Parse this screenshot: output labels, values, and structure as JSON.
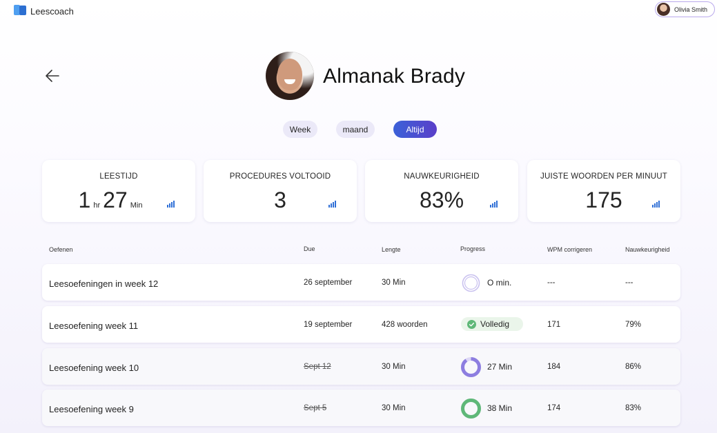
{
  "app": {
    "title": "Leescoach"
  },
  "user": {
    "name": "Olivia Smith"
  },
  "profile": {
    "name": "Almanak Brady"
  },
  "range_tabs": [
    {
      "label": "Week",
      "selected": false
    },
    {
      "label": "maand",
      "selected": false
    },
    {
      "label": "Altijd",
      "selected": true
    }
  ],
  "stats": [
    {
      "label": "LEESTIJD",
      "hours": "1",
      "hours_unit": "hr",
      "minutes": "27",
      "minutes_unit": "Min"
    },
    {
      "label": "PROCEDURES VOLTOOID",
      "value": "3"
    },
    {
      "label": "NAUWKEURIGHEID",
      "value": "83%"
    },
    {
      "label": "JUISTE WOORDEN PER MINUUT",
      "value": "175"
    }
  ],
  "table": {
    "headers": [
      "Oefenen",
      "Due",
      "Lengte",
      "Progress",
      "WPM corrigeren",
      "Nauwkeurigheid"
    ],
    "rows": [
      {
        "name": "Leesoefeningen in week 12",
        "due": "26 september",
        "length": "30 Min",
        "progress_text": "O min.",
        "progress_fraction": 0,
        "wpm": "---",
        "accuracy": "---"
      },
      {
        "name": "Leesoefening week 11",
        "due": "19 september",
        "length": "428 woorden",
        "progress_text": "Volledig",
        "wpm": "171",
        "accuracy": "79%"
      },
      {
        "name": "Leesoefening week 10",
        "due": "Sept 12",
        "length": "30 Min",
        "progress_text": "27 Min",
        "progress_fraction": 0.9,
        "wpm": "184",
        "accuracy": "86%"
      },
      {
        "name": "Leesoefening week 9",
        "due": "Sept 5",
        "length": "30 Min",
        "progress_text": "38 Min",
        "progress_fraction": 1.0,
        "wpm": "174",
        "accuracy": "83%"
      }
    ]
  },
  "colors": {
    "accent_start": "#3b61d8",
    "accent_end": "#5a3fc9",
    "progress_purple": "#8d7ee0",
    "progress_green": "#5fb878",
    "chart_icon_blue": "#2f6fd6"
  },
  "icons": {
    "back": "arrow-left-icon",
    "chart": "bar-chart-icon",
    "complete": "check-circle-icon"
  }
}
